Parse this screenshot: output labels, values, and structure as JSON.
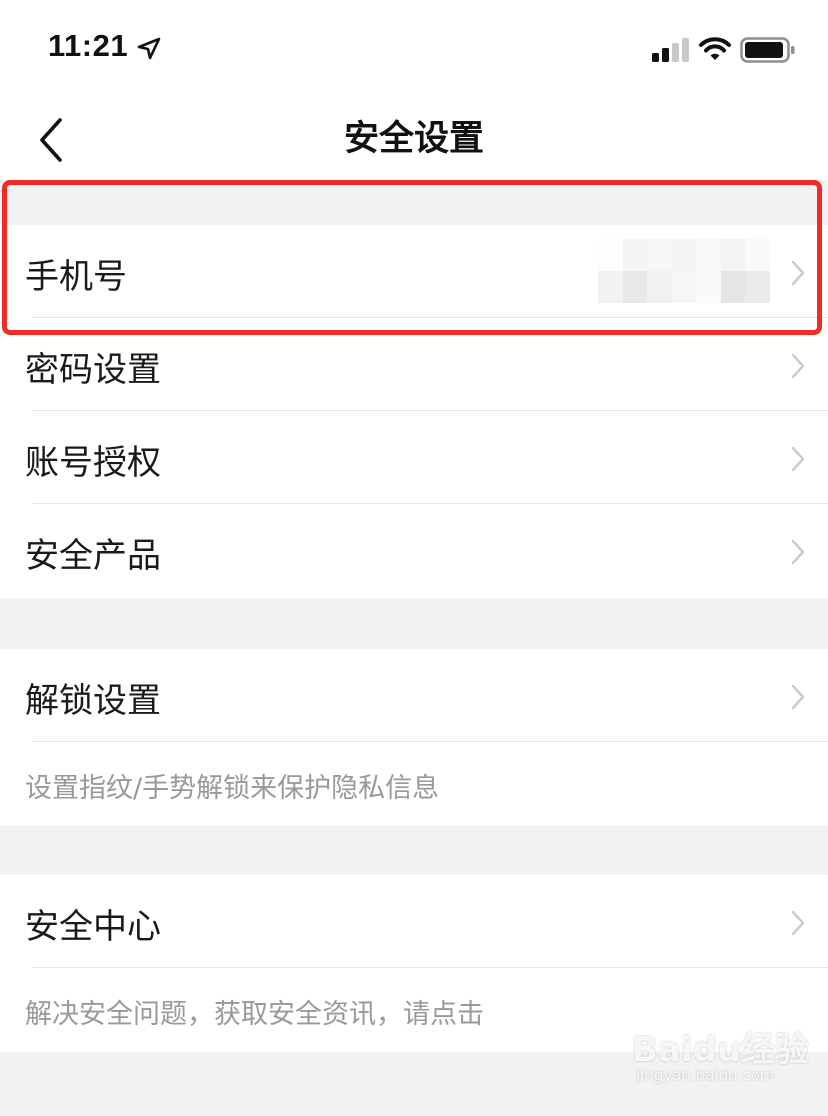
{
  "status_bar": {
    "time": "11:21",
    "icons": [
      "location-arrow-icon",
      "cellular-signal-icon",
      "wifi-icon",
      "battery-icon"
    ]
  },
  "nav": {
    "title": "安全设置",
    "back_icon": "chevron-left-icon"
  },
  "section1": {
    "items": [
      {
        "label": "手机号",
        "value_blurred": true
      },
      {
        "label": "密码设置"
      },
      {
        "label": "账号授权"
      },
      {
        "label": "安全产品"
      }
    ]
  },
  "section2": {
    "items": [
      {
        "label": "解锁设置"
      }
    ],
    "hint": "设置指纹/手势解锁来保护隐私信息"
  },
  "section3": {
    "items": [
      {
        "label": "安全中心"
      }
    ],
    "hint": "解决安全问题，获取安全资讯，请点击"
  },
  "annotation": {
    "highlight_color": "#f42a26"
  },
  "watermark": {
    "main": "Baidu经验",
    "sub": "jingyan.baidu.com"
  },
  "colors": {
    "background": "#f2f2f2",
    "row_bg": "#ffffff",
    "chevron": "#c7c7cc",
    "hint_text": "#999999"
  }
}
